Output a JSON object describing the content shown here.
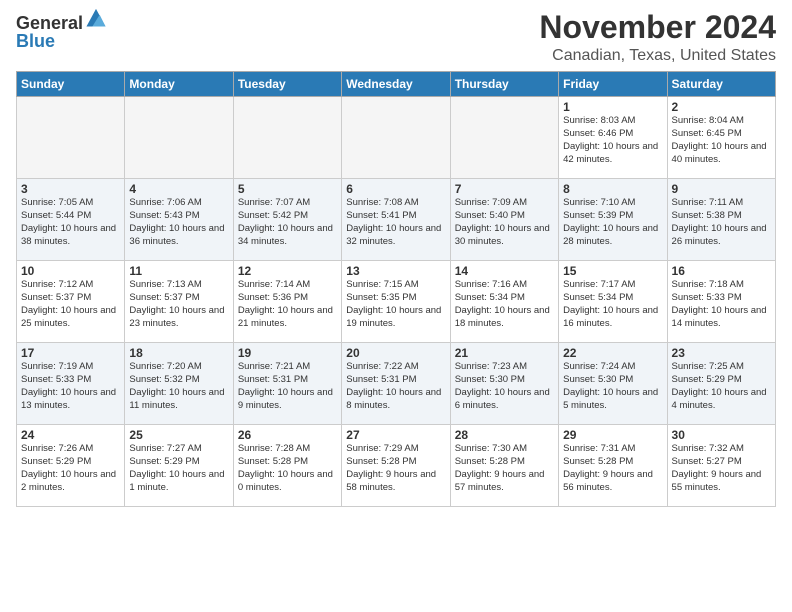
{
  "logo": {
    "general": "General",
    "blue": "Blue"
  },
  "header": {
    "month": "November 2024",
    "location": "Canadian, Texas, United States"
  },
  "weekdays": [
    "Sunday",
    "Monday",
    "Tuesday",
    "Wednesday",
    "Thursday",
    "Friday",
    "Saturday"
  ],
  "weeks": [
    [
      {
        "day": "",
        "empty": true
      },
      {
        "day": "",
        "empty": true
      },
      {
        "day": "",
        "empty": true
      },
      {
        "day": "",
        "empty": true
      },
      {
        "day": "",
        "empty": true
      },
      {
        "day": "1",
        "info": "Sunrise: 8:03 AM\nSunset: 6:46 PM\nDaylight: 10 hours\nand 42 minutes."
      },
      {
        "day": "2",
        "info": "Sunrise: 8:04 AM\nSunset: 6:45 PM\nDaylight: 10 hours\nand 40 minutes."
      }
    ],
    [
      {
        "day": "3",
        "info": "Sunrise: 7:05 AM\nSunset: 5:44 PM\nDaylight: 10 hours\nand 38 minutes."
      },
      {
        "day": "4",
        "info": "Sunrise: 7:06 AM\nSunset: 5:43 PM\nDaylight: 10 hours\nand 36 minutes."
      },
      {
        "day": "5",
        "info": "Sunrise: 7:07 AM\nSunset: 5:42 PM\nDaylight: 10 hours\nand 34 minutes."
      },
      {
        "day": "6",
        "info": "Sunrise: 7:08 AM\nSunset: 5:41 PM\nDaylight: 10 hours\nand 32 minutes."
      },
      {
        "day": "7",
        "info": "Sunrise: 7:09 AM\nSunset: 5:40 PM\nDaylight: 10 hours\nand 30 minutes."
      },
      {
        "day": "8",
        "info": "Sunrise: 7:10 AM\nSunset: 5:39 PM\nDaylight: 10 hours\nand 28 minutes."
      },
      {
        "day": "9",
        "info": "Sunrise: 7:11 AM\nSunset: 5:38 PM\nDaylight: 10 hours\nand 26 minutes."
      }
    ],
    [
      {
        "day": "10",
        "info": "Sunrise: 7:12 AM\nSunset: 5:37 PM\nDaylight: 10 hours\nand 25 minutes."
      },
      {
        "day": "11",
        "info": "Sunrise: 7:13 AM\nSunset: 5:37 PM\nDaylight: 10 hours\nand 23 minutes."
      },
      {
        "day": "12",
        "info": "Sunrise: 7:14 AM\nSunset: 5:36 PM\nDaylight: 10 hours\nand 21 minutes."
      },
      {
        "day": "13",
        "info": "Sunrise: 7:15 AM\nSunset: 5:35 PM\nDaylight: 10 hours\nand 19 minutes."
      },
      {
        "day": "14",
        "info": "Sunrise: 7:16 AM\nSunset: 5:34 PM\nDaylight: 10 hours\nand 18 minutes."
      },
      {
        "day": "15",
        "info": "Sunrise: 7:17 AM\nSunset: 5:34 PM\nDaylight: 10 hours\nand 16 minutes."
      },
      {
        "day": "16",
        "info": "Sunrise: 7:18 AM\nSunset: 5:33 PM\nDaylight: 10 hours\nand 14 minutes."
      }
    ],
    [
      {
        "day": "17",
        "info": "Sunrise: 7:19 AM\nSunset: 5:33 PM\nDaylight: 10 hours\nand 13 minutes."
      },
      {
        "day": "18",
        "info": "Sunrise: 7:20 AM\nSunset: 5:32 PM\nDaylight: 10 hours\nand 11 minutes."
      },
      {
        "day": "19",
        "info": "Sunrise: 7:21 AM\nSunset: 5:31 PM\nDaylight: 10 hours\nand 9 minutes."
      },
      {
        "day": "20",
        "info": "Sunrise: 7:22 AM\nSunset: 5:31 PM\nDaylight: 10 hours\nand 8 minutes."
      },
      {
        "day": "21",
        "info": "Sunrise: 7:23 AM\nSunset: 5:30 PM\nDaylight: 10 hours\nand 6 minutes."
      },
      {
        "day": "22",
        "info": "Sunrise: 7:24 AM\nSunset: 5:30 PM\nDaylight: 10 hours\nand 5 minutes."
      },
      {
        "day": "23",
        "info": "Sunrise: 7:25 AM\nSunset: 5:29 PM\nDaylight: 10 hours\nand 4 minutes."
      }
    ],
    [
      {
        "day": "24",
        "info": "Sunrise: 7:26 AM\nSunset: 5:29 PM\nDaylight: 10 hours\nand 2 minutes."
      },
      {
        "day": "25",
        "info": "Sunrise: 7:27 AM\nSunset: 5:29 PM\nDaylight: 10 hours\nand 1 minute."
      },
      {
        "day": "26",
        "info": "Sunrise: 7:28 AM\nSunset: 5:28 PM\nDaylight: 10 hours\nand 0 minutes."
      },
      {
        "day": "27",
        "info": "Sunrise: 7:29 AM\nSunset: 5:28 PM\nDaylight: 9 hours\nand 58 minutes."
      },
      {
        "day": "28",
        "info": "Sunrise: 7:30 AM\nSunset: 5:28 PM\nDaylight: 9 hours\nand 57 minutes."
      },
      {
        "day": "29",
        "info": "Sunrise: 7:31 AM\nSunset: 5:28 PM\nDaylight: 9 hours\nand 56 minutes."
      },
      {
        "day": "30",
        "info": "Sunrise: 7:32 AM\nSunset: 5:27 PM\nDaylight: 9 hours\nand 55 minutes."
      }
    ]
  ]
}
